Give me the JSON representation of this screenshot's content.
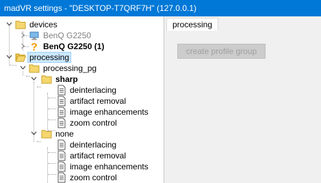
{
  "window": {
    "title": "madVR settings - \"DESKTOP-T7QRF7H\" (127.0.0.1)"
  },
  "tree": {
    "devices": "devices",
    "device_1": "BenQ G2250",
    "device_2": "BenQ G2250 (1)",
    "processing": "processing",
    "processing_pg": "processing_pg",
    "sharp": "sharp",
    "sharp_items": [
      "deinterlacing",
      "artifact removal",
      "image enhancements",
      "zoom control"
    ],
    "none": "none",
    "none_items": [
      "deinterlacing",
      "artifact removal",
      "image enhancements",
      "zoom control"
    ]
  },
  "tabs": {
    "active": "processing"
  },
  "panel": {
    "create_button": "create profile group"
  },
  "icons": {
    "folder": "folder-icon",
    "monitor": "monitor-icon",
    "question": "question-mark-icon",
    "document": "document-icon"
  },
  "colors": {
    "titlebar": "#0078d7",
    "selection": "#cce8ff",
    "folder": "#f5d66f"
  }
}
